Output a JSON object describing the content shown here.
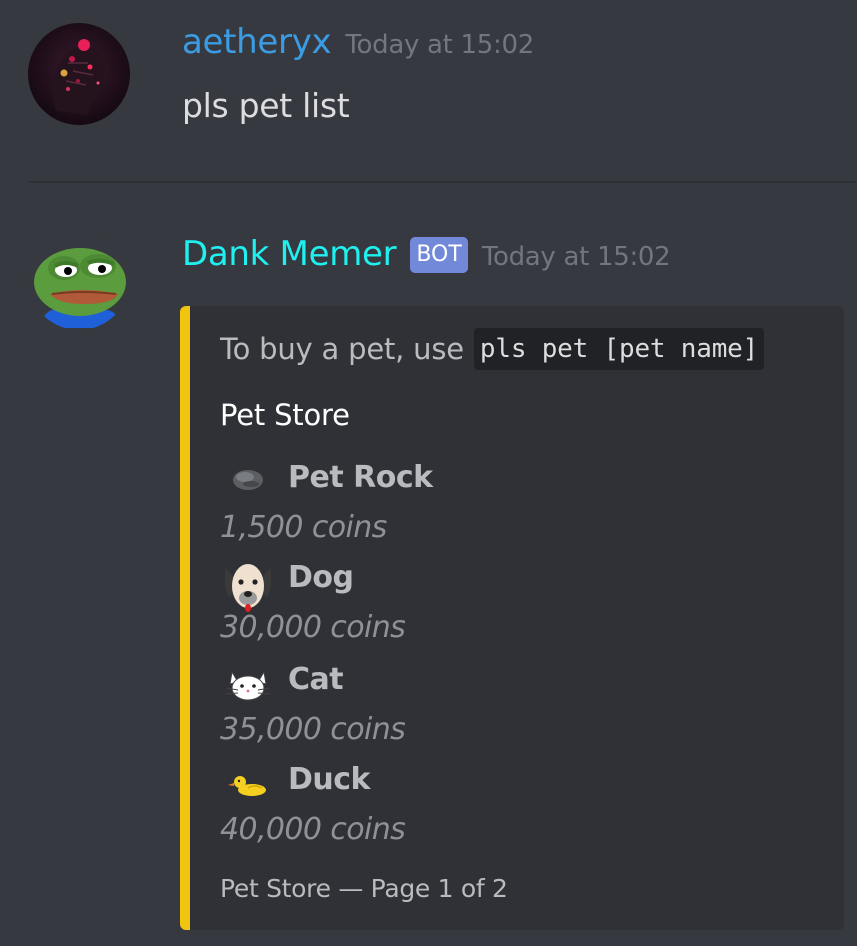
{
  "message_1": {
    "username": "aetheryx",
    "timestamp": "Today at 15:02",
    "content": "pls pet list"
  },
  "message_2": {
    "username": "Dank Memer",
    "badge": "BOT",
    "timestamp": "Today at 15:02",
    "embed": {
      "description_prefix": "To buy a pet, use",
      "description_code": "pls pet [pet name]",
      "title": "Pet Store",
      "accent_color": "#f1c40f",
      "pets": [
        {
          "icon": "rock-icon",
          "name": "Pet Rock",
          "price": "1,500 coins"
        },
        {
          "icon": "dog-icon",
          "name": "Dog",
          "price": "30,000 coins"
        },
        {
          "icon": "cat-icon",
          "name": "Cat",
          "price": "35,000 coins"
        },
        {
          "icon": "duck-icon",
          "name": "Duck",
          "price": "40,000 coins"
        }
      ],
      "footer": "Pet Store — Page 1 of 2"
    }
  },
  "colors": {
    "background": "#36393f",
    "embed_background": "#2f3136",
    "user_color_aetheryx": "#3b9ce4",
    "user_color_dank": "#1ff0f0",
    "bot_badge": "#7289da"
  }
}
